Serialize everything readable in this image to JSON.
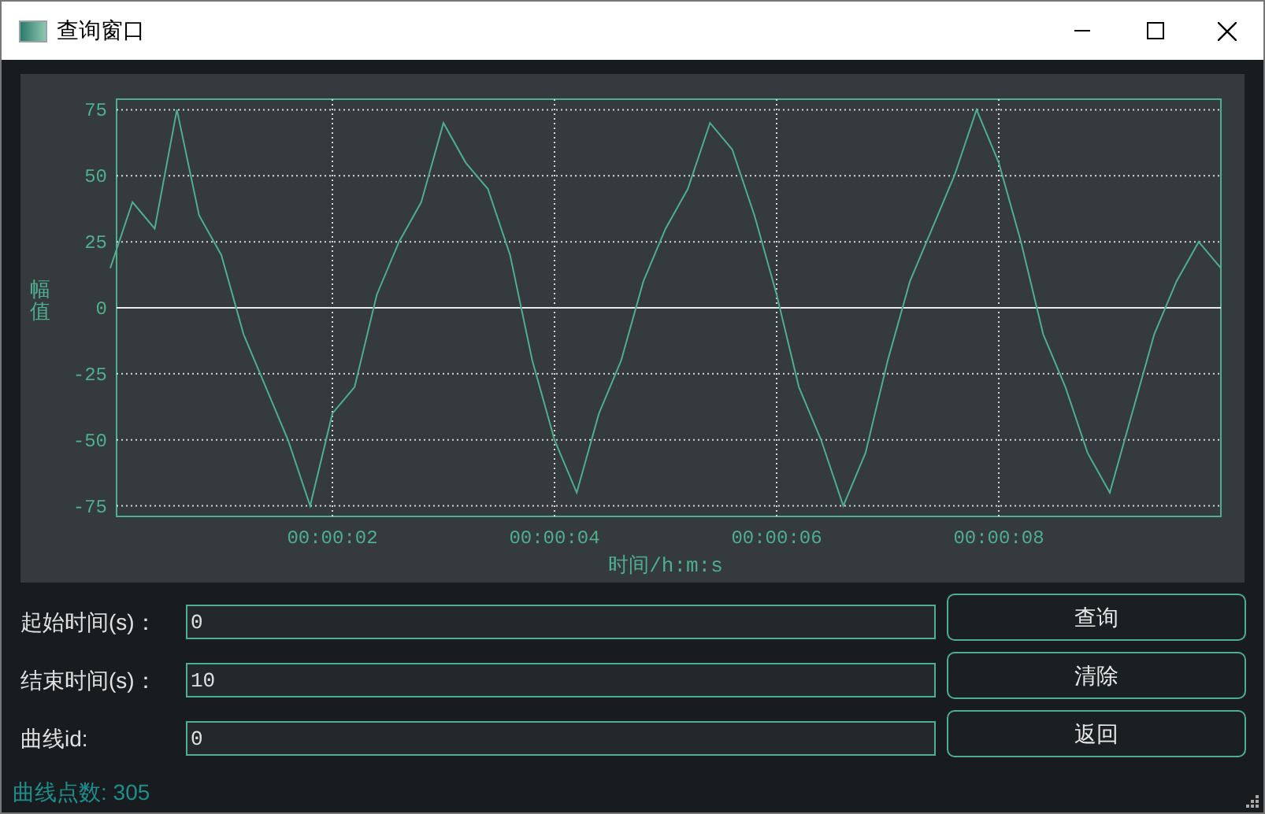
{
  "window": {
    "title": "查询窗口"
  },
  "chart": {
    "chart_data": {
      "type": "line",
      "xlabel": "时间/h:m:s",
      "ylabel": "幅值",
      "x": [
        0,
        0.2,
        0.4,
        0.6,
        0.8,
        1,
        1.2,
        1.4,
        1.6,
        1.8,
        2,
        2.2,
        2.4,
        2.6,
        2.8,
        3,
        3.2,
        3.4,
        3.6,
        3.8,
        4,
        4.2,
        4.4,
        4.6,
        4.8,
        5,
        5.2,
        5.4,
        5.6,
        5.8,
        6,
        6.2,
        6.4,
        6.6,
        6.8,
        7,
        7.2,
        7.4,
        7.6,
        7.8,
        8,
        8.2,
        8.4,
        8.6,
        8.8,
        9,
        9.2,
        9.4,
        9.6,
        9.8,
        10
      ],
      "series": [
        {
          "color": "#4fae8e",
          "values": [
            15,
            40,
            30,
            75,
            35,
            20,
            -10,
            -30,
            -50,
            -75,
            -40,
            -30,
            5,
            25,
            40,
            70,
            55,
            45,
            20,
            -20,
            -50,
            -70,
            -40,
            -20,
            10,
            30,
            45,
            70,
            60,
            35,
            5,
            -30,
            -50,
            -75,
            -55,
            -20,
            10,
            30,
            50,
            75,
            55,
            25,
            -10,
            -30,
            -55,
            -70,
            -40,
            -10,
            10,
            25,
            15
          ]
        }
      ],
      "grid": true,
      "xlim": [
        0,
        10
      ],
      "ylim": [
        -79,
        79
      ],
      "xticks": [
        {
          "value": 2,
          "label": "00:00:02"
        },
        {
          "value": 4,
          "label": "00:00:04"
        },
        {
          "value": 6,
          "label": "00:00:06"
        },
        {
          "value": 8,
          "label": "00:00:08"
        }
      ],
      "yticks": [
        -75,
        -50,
        -25,
        0,
        25,
        50,
        75
      ]
    }
  },
  "form": [
    {
      "label": "起始时间(s)：",
      "value": "0"
    },
    {
      "label": "结束时间(s)：",
      "value": "10"
    },
    {
      "label": "曲线id:",
      "value": "0"
    }
  ],
  "buttons": [
    "查询",
    "清除",
    "返回"
  ],
  "status": "曲线点数: 305"
}
